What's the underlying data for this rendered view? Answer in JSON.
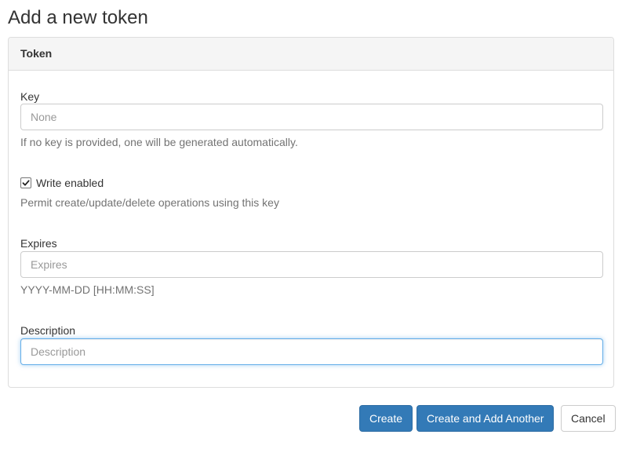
{
  "page": {
    "title": "Add a new token"
  },
  "panel": {
    "heading": "Token"
  },
  "fields": {
    "key": {
      "label": "Key",
      "placeholder": "None",
      "value": "",
      "help": "If no key is provided, one will be generated automatically."
    },
    "write_enabled": {
      "label": "Write enabled",
      "checked": true,
      "help": "Permit create/update/delete operations using this key"
    },
    "expires": {
      "label": "Expires",
      "placeholder": "Expires",
      "value": "",
      "help": "YYYY-MM-DD [HH:MM:SS]"
    },
    "description": {
      "label": "Description",
      "placeholder": "Description",
      "value": "",
      "focused": true
    }
  },
  "actions": {
    "create_label": "Create",
    "create_another_label": "Create and Add Another",
    "cancel_label": "Cancel"
  },
  "colors": {
    "primary": "#337ab7",
    "focus_border": "#66afe9",
    "help_text": "#737373"
  },
  "icons": {
    "checkbox_check": "check-icon"
  }
}
